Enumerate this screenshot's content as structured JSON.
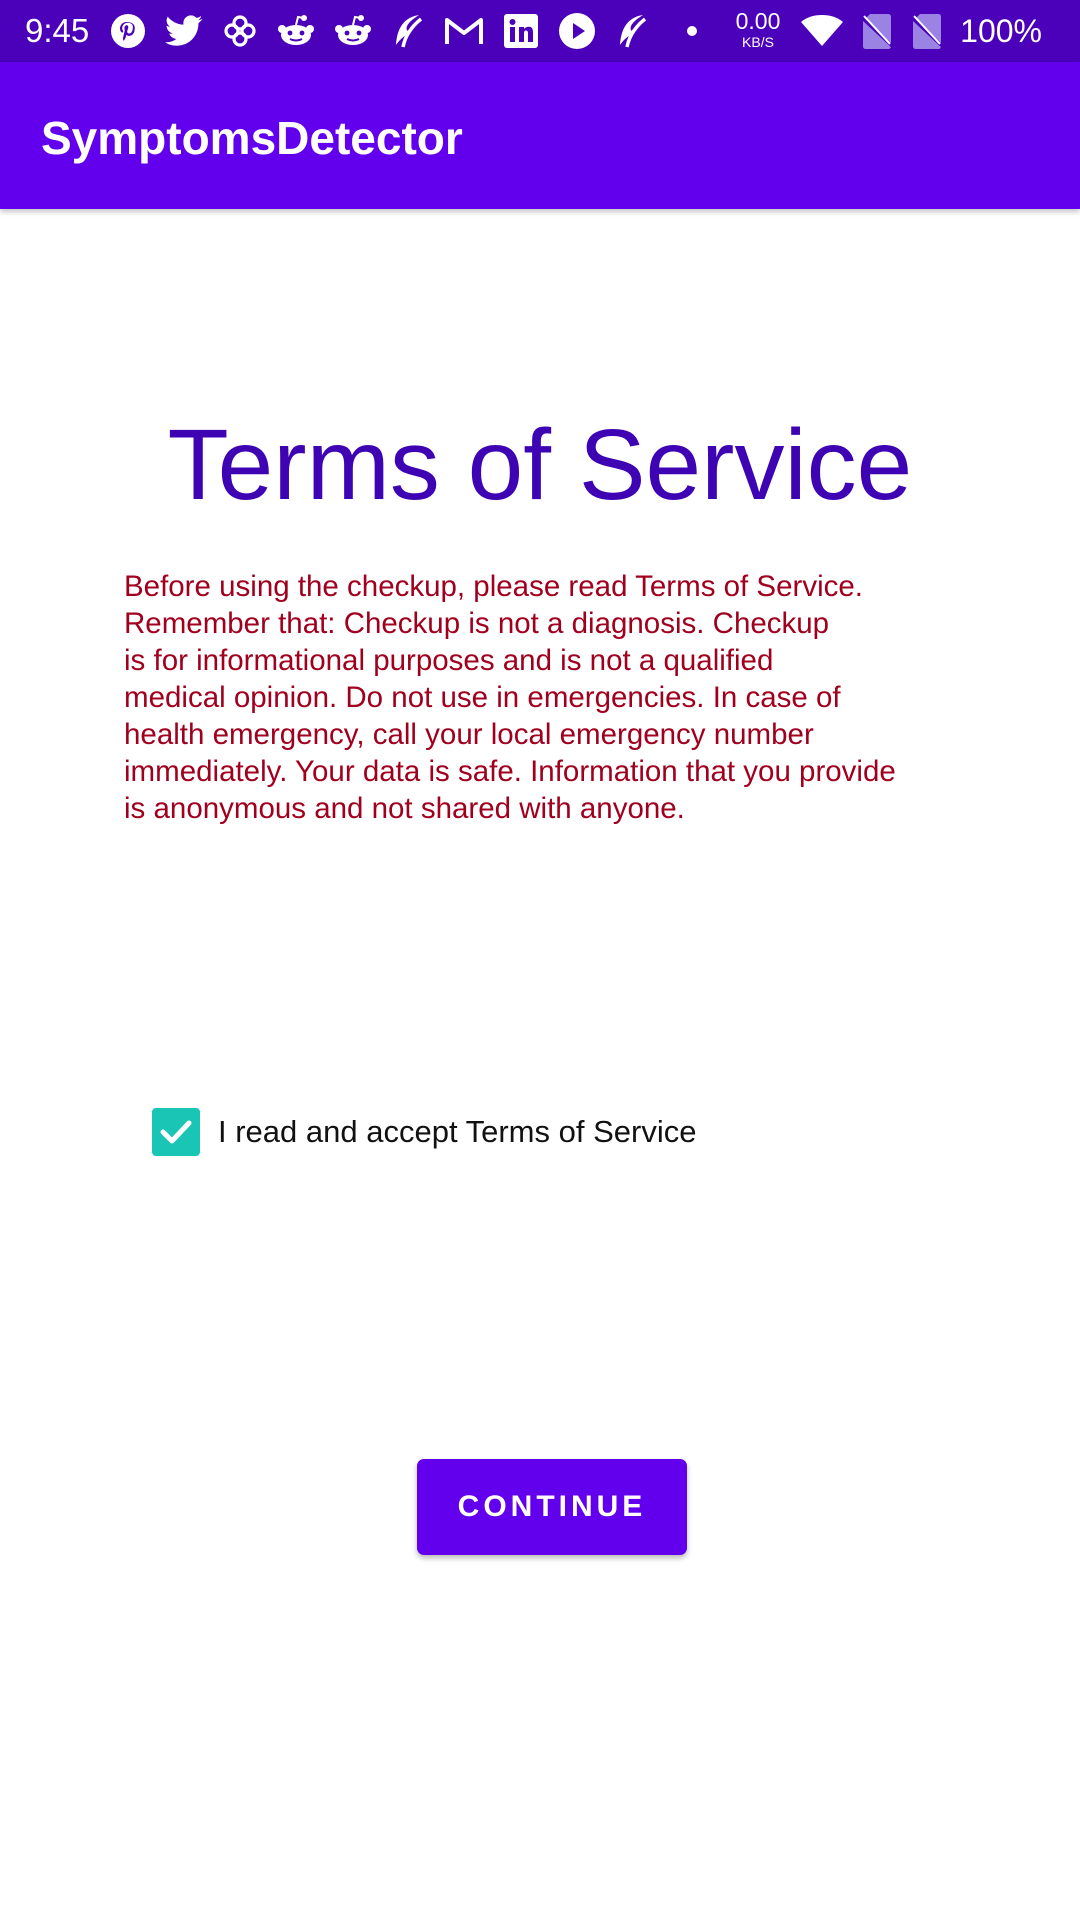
{
  "status_bar": {
    "time": "9:45",
    "net_speed_value": "0.00",
    "net_speed_unit": "KB/S",
    "battery": "100%",
    "notification_icons": [
      "pinterest-icon",
      "twitter-icon",
      "pinwheel-icon",
      "reddit-icon",
      "reddit-icon",
      "app-icon",
      "gmail-icon",
      "linkedin-icon",
      "youtube-icon",
      "app-icon",
      "dot-icon"
    ],
    "system_icons": [
      "wifi-icon",
      "no-sim-icon",
      "no-sim-icon"
    ]
  },
  "app_bar": {
    "title": "SymptomsDetector"
  },
  "content": {
    "heading": "Terms of Service",
    "terms_text": "Before using the checkup, please read Terms of Service.\nRemember that:  Checkup is not a diagnosis. Checkup\nis for informational purposes and is not a qualified\nmedical opinion. Do not use in emergencies. In case of\nhealth emergency, call your local emergency number\nimmediately. Your data is safe. Information that you provide\nis anonymous and not shared with anyone.",
    "accept_checkbox": {
      "label": "I read and accept Terms of Service",
      "checked": true
    },
    "continue_label": "CONTINUE"
  },
  "colors": {
    "status_bar": "#4a01b9",
    "app_bar": "#6200ee",
    "heading": "#3e04b3",
    "terms_text": "#a0001e",
    "checkbox": "#1ac5b5",
    "button": "#6200ee"
  }
}
